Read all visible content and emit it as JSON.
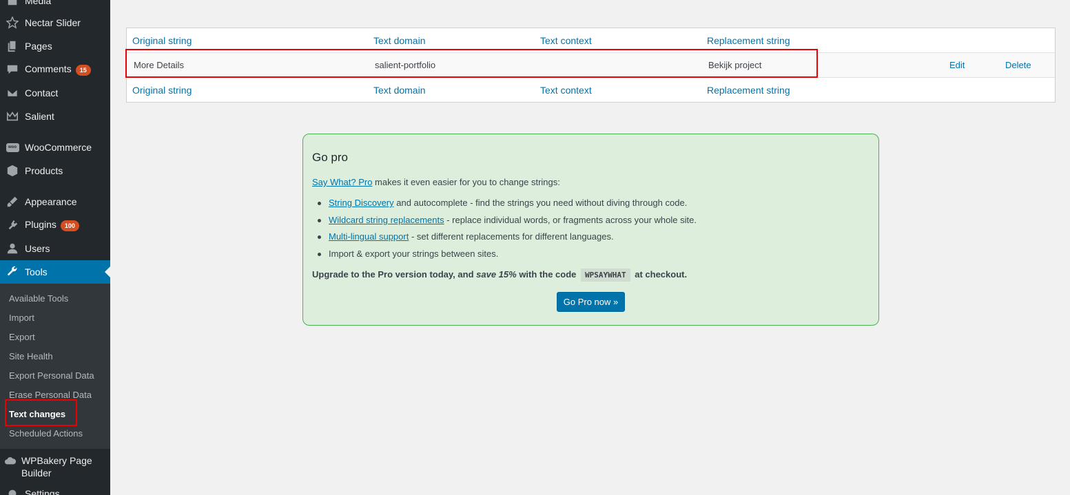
{
  "sidebar": {
    "items": [
      {
        "label": "Media",
        "icon": "media-icon"
      },
      {
        "label": "Nectar Slider",
        "icon": "star-icon"
      },
      {
        "label": "Pages",
        "icon": "pages-icon"
      },
      {
        "label": "Comments",
        "icon": "comments-icon",
        "badge": "15"
      },
      {
        "label": "Contact",
        "icon": "mail-icon"
      },
      {
        "label": "Salient",
        "icon": "crown-icon"
      },
      {
        "label": "WooCommerce",
        "icon": "woo-icon",
        "icon_text": "woo"
      },
      {
        "label": "Products",
        "icon": "box-icon"
      },
      {
        "label": "Appearance",
        "icon": "brush-icon"
      },
      {
        "label": "Plugins",
        "icon": "plug-icon",
        "badge": "100"
      },
      {
        "label": "Users",
        "icon": "user-icon"
      },
      {
        "label": "Tools",
        "icon": "wrench-icon"
      },
      {
        "label": "WPBakery Page Builder",
        "icon": "cloud-icon"
      },
      {
        "label": "Settings",
        "icon": "settings-icon"
      }
    ],
    "tools_submenu": [
      "Available Tools",
      "Import",
      "Export",
      "Site Health",
      "Export Personal Data",
      "Erase Personal Data",
      "Text changes",
      "Scheduled Actions"
    ]
  },
  "table": {
    "headers": [
      "Original string",
      "Text domain",
      "Text context",
      "Replacement string"
    ],
    "rows": [
      {
        "original": "More Details",
        "domain": "salient-portfolio",
        "context": "",
        "replacement": "Bekijk project",
        "edit": "Edit",
        "delete": "Delete"
      }
    ]
  },
  "gopro": {
    "title": "Go pro",
    "intro_link": "Say What? Pro",
    "intro_text": " makes it even easier for you to change strings:",
    "features": [
      {
        "link": "String Discovery",
        "text": " and autocomplete - find the strings you need without diving through code."
      },
      {
        "link": "Wildcard string replacements",
        "text": " - replace individual words, or fragments across your whole site."
      },
      {
        "link": "Multi-lingual support",
        "text": " - set different replacements for different languages."
      },
      {
        "link": "",
        "text": "Import & export your strings between sites."
      }
    ],
    "upgrade_pre": "Upgrade to the Pro version today, and ",
    "upgrade_em": "save 15%",
    "upgrade_mid": " with the code ",
    "code": "WPSAYWHAT",
    "upgrade_post": " at checkout.",
    "button": "Go Pro now »"
  },
  "colors": {
    "sidebar_bg": "#23282d",
    "submenu_bg": "#32373c",
    "accent": "#0073aa",
    "badge": "#d54e21",
    "gopro_bg": "#ddeedc",
    "gopro_border": "#46b450",
    "highlight": "#e00000"
  }
}
